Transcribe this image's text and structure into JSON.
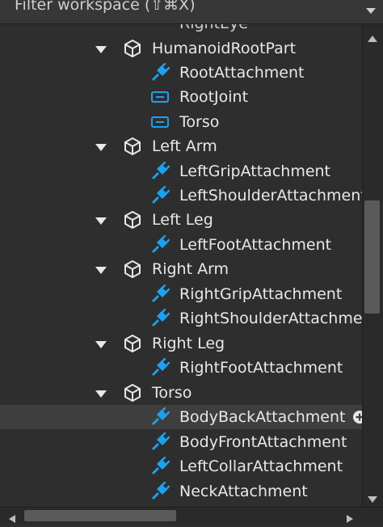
{
  "filter": {
    "placeholder": "Filter workspace (⇧⌘X)",
    "dropdown_icon": "chevron-down-icon"
  },
  "colors": {
    "background": "#2e2e2e",
    "selected_row": "#3e3e3e",
    "attachment_icon": "#1ea0f0",
    "joint_icon": "#1ea0f0",
    "text": "#e8e8e8"
  },
  "tree": {
    "partial_top_label": "RightEye",
    "rows": [
      {
        "label": "HumanoidRootPart",
        "kind": "part",
        "expanded": true
      },
      {
        "label": "RootAttachment",
        "kind": "attachment"
      },
      {
        "label": "RootJoint",
        "kind": "joint"
      },
      {
        "label": "Torso",
        "kind": "joint"
      },
      {
        "label": "Left Arm",
        "kind": "part",
        "expanded": true
      },
      {
        "label": "LeftGripAttachment",
        "kind": "attachment"
      },
      {
        "label": "LeftShoulderAttachment",
        "kind": "attachment"
      },
      {
        "label": "Left Leg",
        "kind": "part",
        "expanded": true
      },
      {
        "label": "LeftFootAttachment",
        "kind": "attachment"
      },
      {
        "label": "Right Arm",
        "kind": "part",
        "expanded": true
      },
      {
        "label": "RightGripAttachment",
        "kind": "attachment"
      },
      {
        "label": "RightShoulderAttachment",
        "kind": "attachment"
      },
      {
        "label": "Right Leg",
        "kind": "part",
        "expanded": true
      },
      {
        "label": "RightFootAttachment",
        "kind": "attachment"
      },
      {
        "label": "Torso",
        "kind": "part",
        "expanded": true
      },
      {
        "label": "BodyBackAttachment",
        "kind": "attachment",
        "selected": true
      },
      {
        "label": "BodyFrontAttachment",
        "kind": "attachment"
      },
      {
        "label": "LeftCollarAttachment",
        "kind": "attachment"
      },
      {
        "label": "NeckAttachment",
        "kind": "attachment"
      }
    ]
  }
}
